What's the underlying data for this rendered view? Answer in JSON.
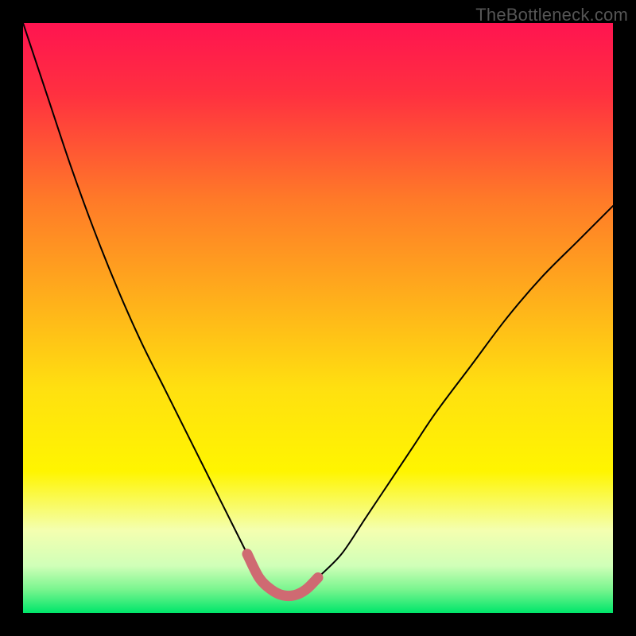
{
  "watermark": "TheBottleneck.com",
  "colors": {
    "frame": "#000000",
    "curve": "#000000",
    "highlight": "#cf6a72",
    "gradient_top": "#ff1450",
    "gradient_mid_orange": "#ff9a1a",
    "gradient_mid_yellow": "#fff500",
    "gradient_pale": "#f7ffd0",
    "gradient_bottom": "#00e66a"
  },
  "chart_data": {
    "type": "line",
    "title": "",
    "xlabel": "",
    "ylabel": "",
    "xlim": [
      0,
      100
    ],
    "ylim": [
      0,
      100
    ],
    "x": [
      0,
      4,
      8,
      12,
      16,
      20,
      24,
      28,
      32,
      36,
      38,
      40,
      42,
      44,
      46,
      48,
      50,
      54,
      58,
      62,
      66,
      70,
      76,
      82,
      88,
      94,
      100
    ],
    "values": [
      100,
      88,
      76,
      65,
      55,
      46,
      38,
      30,
      22,
      14,
      10,
      6,
      4,
      3,
      3,
      4,
      6,
      10,
      16,
      22,
      28,
      34,
      42,
      50,
      57,
      63,
      69
    ],
    "highlight_range_x": [
      36,
      51
    ],
    "highlight_range_y_max": 12,
    "note": "V-shaped bottleneck curve. x and y are percentages of the plot area (0 bottom-left). Minimum ≈3 around x≈44–46. Highlight marks the near-optimal region around the trough."
  }
}
